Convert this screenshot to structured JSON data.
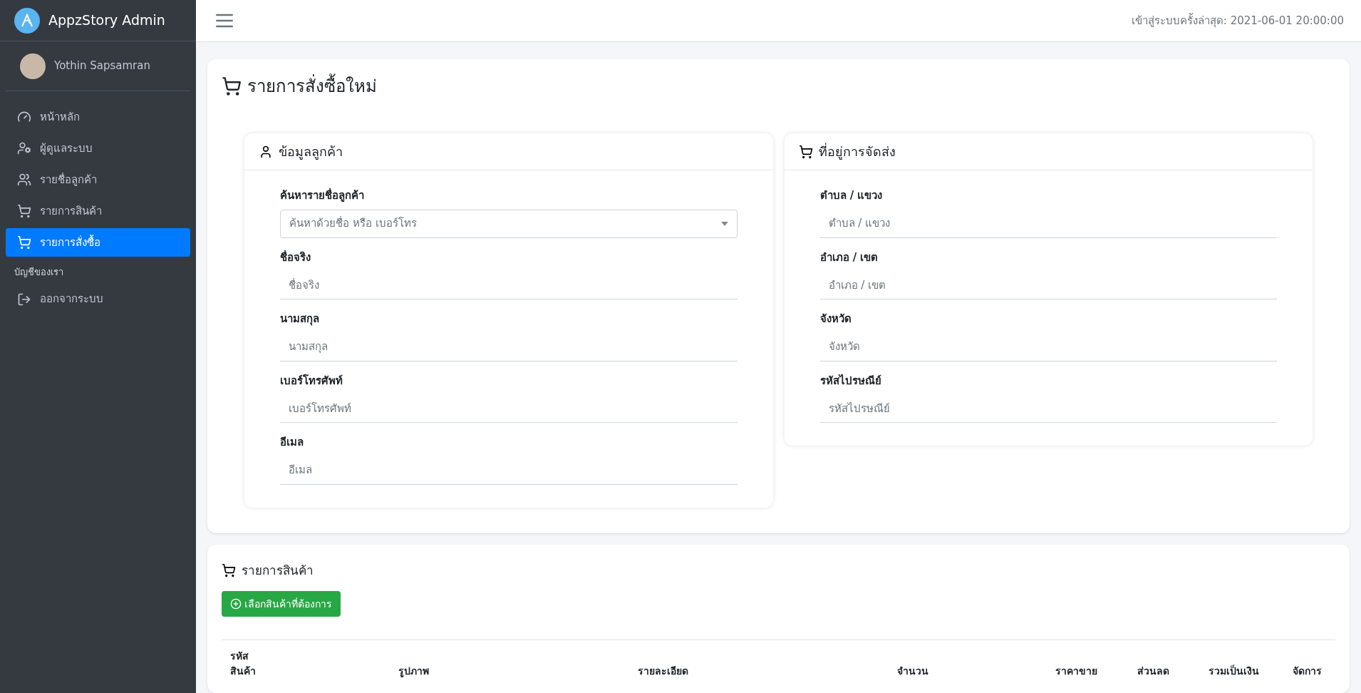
{
  "sidebar": {
    "brand": "AppzStory Admin",
    "user": "Yothin Sapsamran",
    "items": [
      {
        "label": "หน้าหลัก",
        "selected": false
      },
      {
        "label": "ผู้ดูแลระบบ",
        "selected": false
      },
      {
        "label": "รายชื่อลูกค้า",
        "selected": false
      },
      {
        "label": "รายการสินค้า",
        "selected": false
      },
      {
        "label": "รายการสั่งซื้อ",
        "selected": true
      }
    ],
    "section": "บัญชีของเรา",
    "account_items": [
      {
        "label": "ออกจากระบบ",
        "selected": false
      }
    ]
  },
  "header": {
    "last_login": "เข้าสู่ระบบครั้งล่าสุด: 2021-06-01 20:00:00"
  },
  "page_title": "รายการสั่งซื้อใหม่",
  "customer_card": {
    "title": "ข้อมูลลูกค้า",
    "fields": [
      {
        "kind": "select",
        "label": "ค้นหารายชื่อลูกค้า",
        "placeholder": "ค้นหาด้วยชื่อ หรือ เบอร์โทร"
      },
      {
        "kind": "text",
        "label": "ชื่อจริง",
        "placeholder": "ชื่อจริง"
      },
      {
        "kind": "text",
        "label": "นามสกุล",
        "placeholder": "นามสกุล"
      },
      {
        "kind": "text",
        "label": "เบอร์โทรศัพท์",
        "placeholder": "เบอร์โทรศัพท์"
      },
      {
        "kind": "text",
        "label": "อีเมล",
        "placeholder": "อีเมล"
      }
    ]
  },
  "shipping_card": {
    "title": "ที่อยู่การจัดส่ง",
    "fields": [
      {
        "kind": "text",
        "label": "ตำบล / แขวง",
        "placeholder": "ตำบล / แขวง"
      },
      {
        "kind": "text",
        "label": "อำเภอ / เขต",
        "placeholder": "อำเภอ / เขต"
      },
      {
        "kind": "text",
        "label": "จังหวัด",
        "placeholder": "จังหวัด"
      },
      {
        "kind": "text",
        "label": "รหัสไปรษณีย์",
        "placeholder": "รหัสไปรษณีย์"
      }
    ]
  },
  "products": {
    "title": "รายการสินค้า",
    "add_button": "เลือกสินค้าที่ต้องการ",
    "columns": [
      "รหัส สินค้า",
      "รูปภาพ",
      "รายละเอียด",
      "จำนวน",
      "ราคาขาย",
      "ส่วนลด",
      "รวมเป็นเงิน",
      "จัดการ"
    ]
  }
}
